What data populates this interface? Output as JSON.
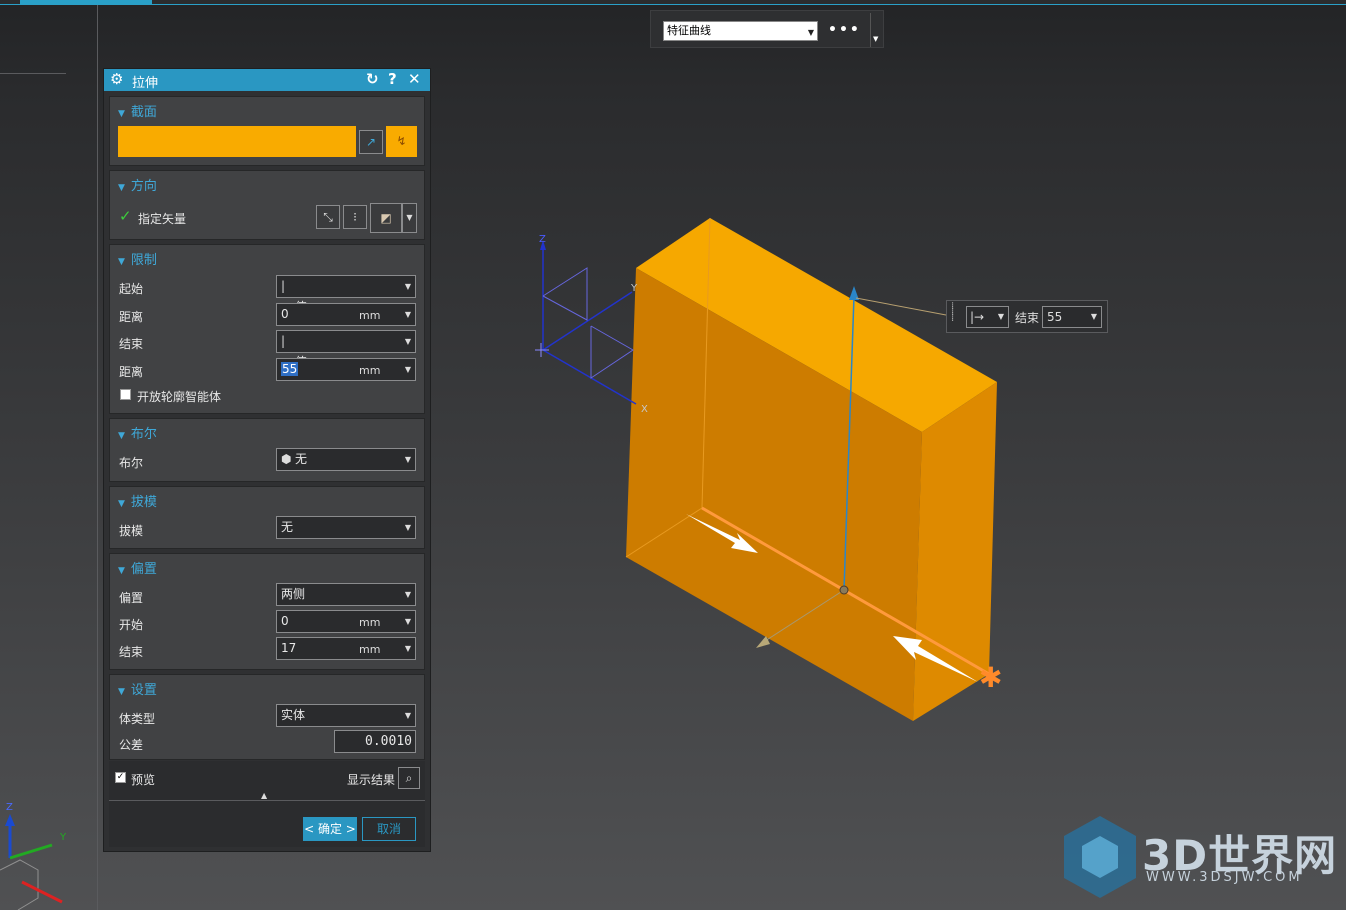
{
  "toolbar": {
    "filter_value": "特征曲线",
    "more_label": "•••"
  },
  "dialog": {
    "title": "拉伸",
    "section": {
      "header": "截面"
    },
    "direction": {
      "header": "方向",
      "specify_vector": "指定矢量"
    },
    "limits": {
      "header": "限制",
      "start_label": "起始",
      "start_value": "值",
      "start_distance_label": "距离",
      "start_distance_value": "0",
      "end_label": "结束",
      "end_value": "值",
      "end_distance_label": "距离",
      "end_distance_value": "55",
      "unit": "mm",
      "open_profile_label": "开放轮廓智能体"
    },
    "boolean": {
      "header": "布尔",
      "label": "布尔",
      "value": "无"
    },
    "draft": {
      "header": "拔模",
      "label": "拔模",
      "value": "无"
    },
    "offset": {
      "header": "偏置",
      "label": "偏置",
      "value": "两侧",
      "start_label": "开始",
      "start_value": "0",
      "end_label": "结束",
      "end_value": "17",
      "unit": "mm"
    },
    "settings": {
      "header": "设置",
      "body_type_label": "体类型",
      "body_type_value": "实体",
      "tolerance_label": "公差",
      "tolerance_value": "0.0010"
    },
    "preview_label": "预览",
    "show_result_label": "显示结果",
    "ok_label": "< 确定 >",
    "cancel_label": "取消"
  },
  "end_handle": {
    "label": "结束",
    "value": "55"
  },
  "axes_labels": {
    "x": "X",
    "y": "Y",
    "z": "Z"
  },
  "watermark": {
    "main": "3D世界网",
    "sub": "WWW.3DSJW.COM"
  },
  "colors": {
    "accent": "#2a97c2",
    "section_highlight": "#f9ab00",
    "body": "#f0a000"
  }
}
